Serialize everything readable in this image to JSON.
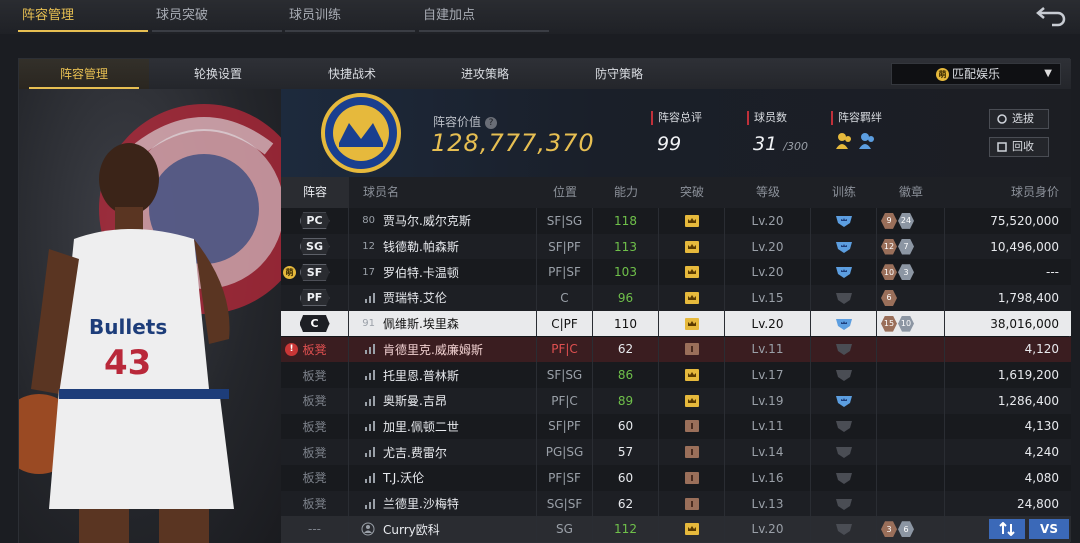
{
  "top_tabs": [
    {
      "label": "阵容管理",
      "active": true
    },
    {
      "label": "球员突破",
      "active": false
    },
    {
      "label": "球员训练",
      "active": false
    },
    {
      "label": "自建加点",
      "active": false
    }
  ],
  "sub_tabs": [
    {
      "label": "阵容管理",
      "active": true
    },
    {
      "label": "轮换设置",
      "active": false
    },
    {
      "label": "快捷战术",
      "active": false
    },
    {
      "label": "进攻策略",
      "active": false
    },
    {
      "label": "防守策略",
      "active": false
    }
  ],
  "mode_select": {
    "coin_icon": "coin-icon",
    "value": "匹配娱乐"
  },
  "header": {
    "value_label": "阵容价值",
    "value": "128,777,370",
    "overall_label": "阵容总评",
    "overall": "99",
    "count_label": "球员数",
    "count": "31",
    "count_max": "/300",
    "bond_label": "阵容羁绊",
    "buttons": {
      "pick": "选拔",
      "recycle": "回收"
    }
  },
  "columns": [
    "阵容",
    "球员名",
    "位置",
    "能力",
    "突破",
    "等级",
    "训练",
    "徽章",
    "球员身价"
  ],
  "players": [
    {
      "slot": "PC",
      "num": "80",
      "name": "贾马尔.威尔克斯",
      "pos": "SF|SG",
      "ability": "118",
      "ability_color": "green",
      "brk": "gold",
      "level": "Lv.20",
      "train": "blue",
      "badges": [
        "9",
        "24"
      ],
      "price": "75,520,000"
    },
    {
      "slot": "SG",
      "num": "12",
      "name": "钱德勒.帕森斯",
      "pos": "SF|PF",
      "ability": "113",
      "ability_color": "green",
      "brk": "gold",
      "level": "Lv.20",
      "train": "blue",
      "badges": [
        "12",
        "7"
      ],
      "price": "10,496,000"
    },
    {
      "slot": "SF",
      "num": "17",
      "name": "罗伯特.卡温顿",
      "pos": "PF|SF",
      "ability": "103",
      "ability_color": "green",
      "brk": "gold",
      "level": "Lv.20",
      "train": "blue",
      "badges": [
        "10",
        "3"
      ],
      "price": "---",
      "starter": "萌"
    },
    {
      "slot": "PF",
      "num": "",
      "name": "贾瑞特.艾伦",
      "pos": "C",
      "ability": "96",
      "ability_color": "green",
      "brk": "gold",
      "level": "Lv.15",
      "train": "gray",
      "badges": [
        "6"
      ],
      "price": "1,798,400"
    },
    {
      "slot": "C",
      "num": "91",
      "name": "佩维斯.埃里森",
      "pos": "C|PF",
      "ability": "110",
      "ability_color": "white",
      "brk": "gold",
      "level": "Lv.20",
      "train": "blue",
      "badges": [
        "15",
        "10"
      ],
      "price": "38,016,000",
      "selected": true
    },
    {
      "slot": "板凳",
      "num": "",
      "name": "肯德里克.威廉姆斯",
      "pos": "PF|C",
      "ability": "62",
      "ability_color": "white",
      "brk": "bronze",
      "level": "Lv.11",
      "train": "gray",
      "badges": [],
      "price": "4,120",
      "warning": true
    },
    {
      "slot": "板凳",
      "num": "",
      "name": "托里恩.普林斯",
      "pos": "SF|SG",
      "ability": "86",
      "ability_color": "green",
      "brk": "gold",
      "level": "Lv.17",
      "train": "gray",
      "badges": [],
      "price": "1,619,200"
    },
    {
      "slot": "板凳",
      "num": "",
      "name": "奥斯曼.吉昂",
      "pos": "PF|C",
      "ability": "89",
      "ability_color": "green",
      "brk": "gold",
      "level": "Lv.19",
      "train": "blue",
      "badges": [],
      "price": "1,286,400"
    },
    {
      "slot": "板凳",
      "num": "",
      "name": "加里.佩顿二世",
      "pos": "SF|PF",
      "ability": "60",
      "ability_color": "white",
      "brk": "bronze",
      "level": "Lv.11",
      "train": "gray",
      "badges": [],
      "price": "4,130"
    },
    {
      "slot": "板凳",
      "num": "",
      "name": "尤吉.费雷尔",
      "pos": "PG|SG",
      "ability": "57",
      "ability_color": "white",
      "brk": "bronze",
      "level": "Lv.14",
      "train": "gray",
      "badges": [],
      "price": "4,240"
    },
    {
      "slot": "板凳",
      "num": "",
      "name": "T.J.沃伦",
      "pos": "PF|SF",
      "ability": "60",
      "ability_color": "white",
      "brk": "bronze",
      "level": "Lv.16",
      "train": "gray",
      "badges": [],
      "price": "4,080"
    },
    {
      "slot": "板凳",
      "num": "",
      "name": "兰德里.沙梅特",
      "pos": "SG|SF",
      "ability": "62",
      "ability_color": "white",
      "brk": "bronze",
      "level": "Lv.13",
      "train": "gray",
      "badges": [],
      "price": "24,800"
    },
    {
      "slot": "---",
      "num": "",
      "name": "Curry欧科",
      "pos": "SG",
      "ability": "112",
      "ability_color": "green",
      "brk": "gold",
      "level": "Lv.20",
      "train": "gray",
      "badges": [
        "3",
        "6"
      ],
      "price": "",
      "curry": true
    }
  ],
  "actions": {
    "swap_icon": "swap-arrows-icon",
    "vs": "VS"
  },
  "colors": {
    "gold": "#e7bf52",
    "green": "#6fc04a",
    "bench_red": "#e05050",
    "action_blue": "#3b69b8"
  }
}
